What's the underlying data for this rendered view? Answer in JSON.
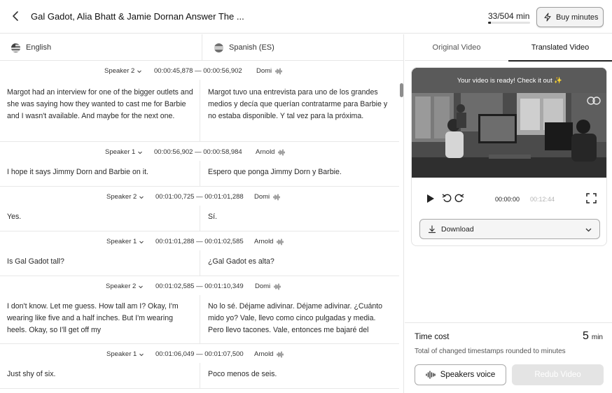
{
  "header": {
    "title": "Gal Gadot, Alia Bhatt & Jamie Dornan Answer The ...",
    "minutes_used": "33/504 min",
    "minutes_fraction": 0.065,
    "buy_label": "Buy minutes"
  },
  "languages": {
    "source": "English",
    "target": "Spanish (ES)"
  },
  "segments": [
    {
      "speaker": "Speaker 2",
      "timestamp": "00:00:45,878 — 00:00:56,902",
      "voice": "Domi",
      "source": "Margot had an interview for one of the bigger outlets and she was saying how they wanted to cast me for Barbie and I wasn't available. And maybe for the next one.",
      "target": "Margot tuvo una entrevista para uno de los grandes medios y decía que querían contratarme para Barbie y no estaba disponible. Y tal vez para la próxima."
    },
    {
      "speaker": "Speaker 1",
      "timestamp": "00:00:56,902 — 00:00:58,984",
      "voice": "Arnold",
      "source": "I hope it says Jimmy Dorn and Barbie on it.",
      "target": "Espero que ponga Jimmy Dorn y Barbie."
    },
    {
      "speaker": "Speaker 2",
      "timestamp": "00:01:00,725 — 00:01:01,288",
      "voice": "Domi",
      "source": "Yes.",
      "target": "Sí."
    },
    {
      "speaker": "Speaker 1",
      "timestamp": "00:01:01,288 — 00:01:02,585",
      "voice": "Arnold",
      "source": "Is Gal Gadot tall?",
      "target": "¿Gal Gadot es alta?"
    },
    {
      "speaker": "Speaker 2",
      "timestamp": "00:01:02,585 — 00:01:10,349",
      "voice": "Domi",
      "source": "I don't know. Let me guess. How tall am I? Okay, I'm wearing like five and a half inches. But I'm wearing heels. Okay, so I'll get off my",
      "target": "No lo sé. Déjame adivinar. Déjame adivinar. ¿Cuánto mido yo? Vale, llevo como cinco pulgadas y media. Pero llevo tacones. Vale, entonces me bajaré del"
    },
    {
      "speaker": "Speaker 1",
      "timestamp": "00:01:06,049 — 00:01:07,500",
      "voice": "Arnold",
      "source": "Just shy of six.",
      "target": "Poco menos de seis."
    }
  ],
  "tabs": {
    "original": "Original Video",
    "translated": "Translated Video"
  },
  "player": {
    "banner": "Your video is ready! Check it out ✨",
    "current_time": "00:00:00",
    "total_time": "00:12:44",
    "download_label": "Download"
  },
  "cost": {
    "title": "Time cost",
    "value": "5",
    "unit": "min",
    "subtitle": "Total of changed timestamps rounded to minutes",
    "speakers_voice_label": "Speakers voice",
    "redub_label": "Redub Video"
  }
}
